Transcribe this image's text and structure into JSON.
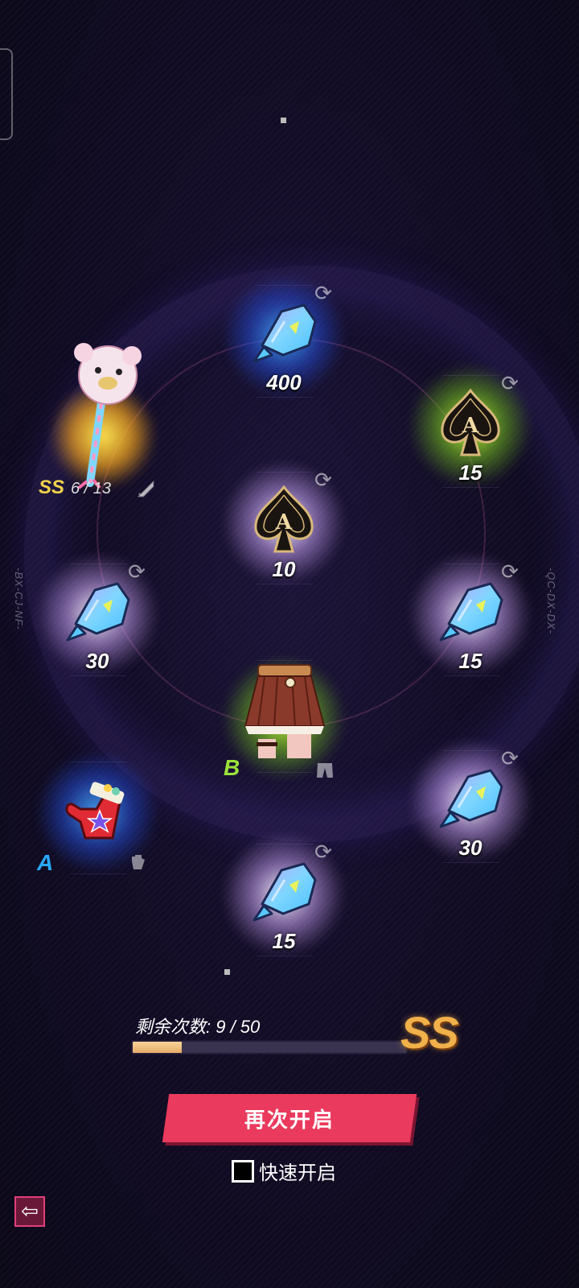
{
  "left_code": "-BX-CJ-NF-",
  "right_code": "-QC-DX-DX-",
  "slots": [
    {
      "id": "top",
      "item": "fish",
      "quantity": "400",
      "refresh": true
    },
    {
      "id": "right-upper",
      "item": "ace",
      "quantity": "15",
      "refresh": true
    },
    {
      "id": "left-upper",
      "item": "bear-staff",
      "grade": "SS",
      "progress": "6 / 13",
      "type_icon": "sword-icon"
    },
    {
      "id": "center",
      "item": "ace",
      "quantity": "10",
      "refresh": true
    },
    {
      "id": "left-middle",
      "item": "fish",
      "quantity": "30",
      "refresh": true
    },
    {
      "id": "right-middle",
      "item": "fish",
      "quantity": "15",
      "refresh": true
    },
    {
      "id": "center-lower",
      "item": "skirt",
      "grade": "B",
      "type_icon": "pants-icon"
    },
    {
      "id": "left-lower",
      "item": "mitten",
      "grade": "A",
      "type_icon": "glove-icon"
    },
    {
      "id": "right-lower",
      "item": "fish",
      "quantity": "30",
      "refresh": true
    },
    {
      "id": "bottom",
      "item": "fish",
      "quantity": "15",
      "refresh": true
    }
  ],
  "progress": {
    "label": "剩余次数: 9 / 50",
    "remaining": 9,
    "total": 50,
    "grade": "SS"
  },
  "reopen_button": "再次开启",
  "quick_open": {
    "label": "快速开启",
    "checked": false
  },
  "back_button": "back-arrow-icon",
  "colors": {
    "button": "#ea3a5d",
    "grade_ss": "#f0b04a",
    "grade_b": "#9be23a",
    "grade_a": "#2aa8ff",
    "progress_fill": "#e6ad68"
  }
}
